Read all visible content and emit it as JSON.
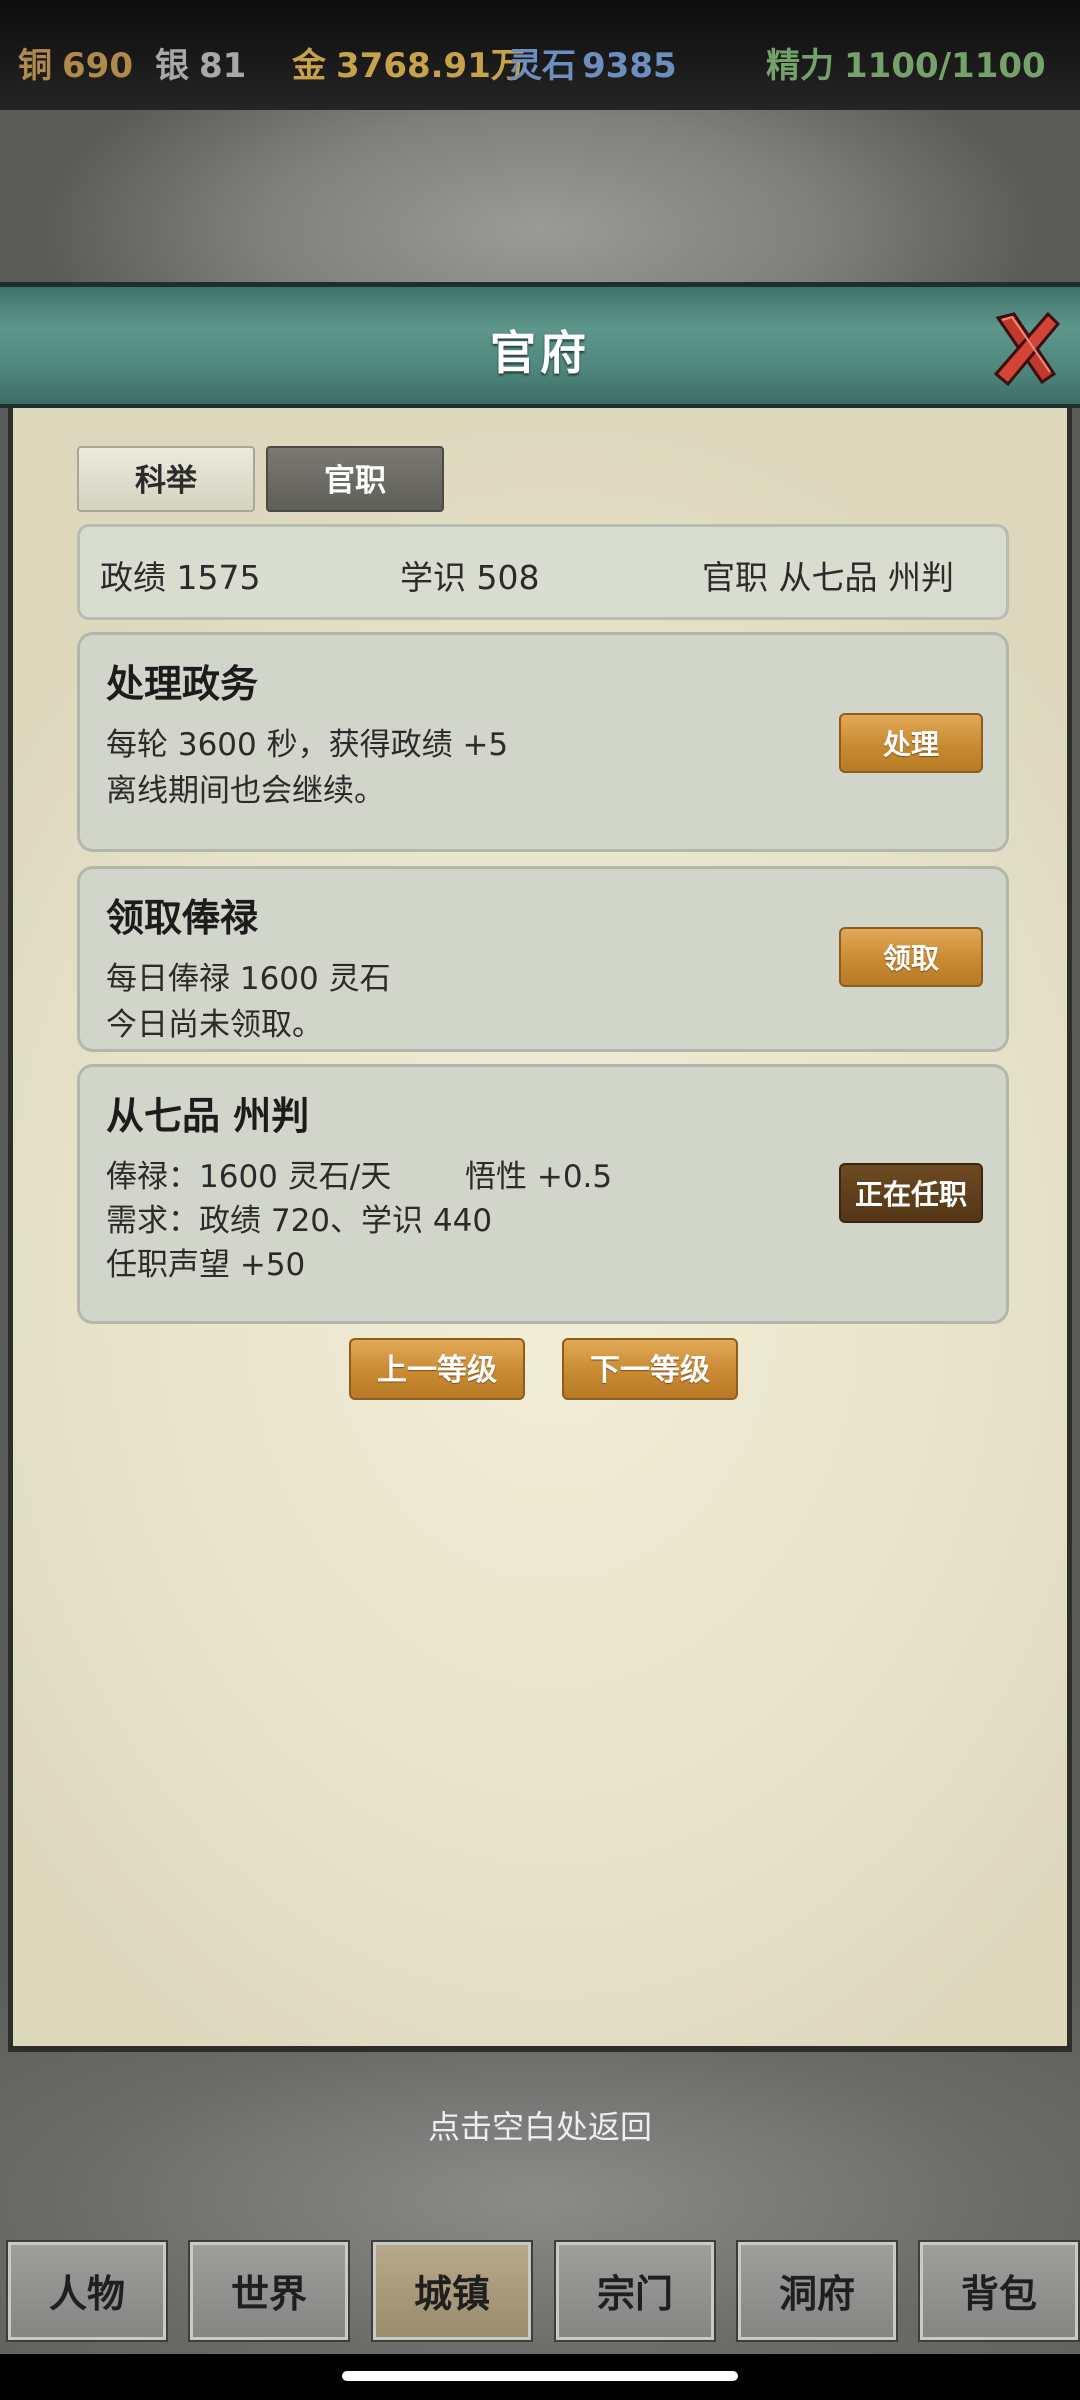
{
  "resources": {
    "copper": {
      "label": "铜",
      "value": "690"
    },
    "silver": {
      "label": "银",
      "value": "81"
    },
    "gold": {
      "label": "金",
      "value": "3768.91万"
    },
    "spirit_stone": {
      "label": "灵石",
      "value": "9385"
    },
    "energy": {
      "label": "精力",
      "value": "1100/1100"
    }
  },
  "dialog": {
    "title": "官府",
    "close_icon": "close-x-icon",
    "tabs": [
      {
        "label": "科举",
        "selected": false
      },
      {
        "label": "官职",
        "selected": true
      }
    ],
    "stats": {
      "merit": "政绩 1575",
      "knowledge": "学识 508",
      "office": "官职 从七品 州判"
    },
    "cards": [
      {
        "title": "处理政务",
        "lines": [
          "每轮 3600 秒，获得政绩 +5",
          "离线期间也会继续。"
        ],
        "button": "处理"
      },
      {
        "title": "领取俸禄",
        "lines": [
          "每日俸禄 1600 灵石",
          "今日尚未领取。"
        ],
        "button": "领取"
      },
      {
        "title": "从七品 州判",
        "lines": [
          "俸禄：1600 灵石/天",
          "悟性 +0.5",
          "需求：政绩 720、学识 440",
          "任职声望 +50"
        ],
        "button": "正在任职"
      }
    ],
    "prev_level": "上一等级",
    "next_level": "下一等级"
  },
  "hint": "点击空白处返回",
  "bottom_nav": [
    {
      "label": "人物",
      "active": false
    },
    {
      "label": "世界",
      "active": false
    },
    {
      "label": "城镇",
      "active": true
    },
    {
      "label": "宗门",
      "active": false
    },
    {
      "label": "洞府",
      "active": false
    },
    {
      "label": "背包",
      "active": false
    }
  ],
  "colors": {
    "header_teal": "#4f877c",
    "parchment": "#e9e5cc",
    "gold_button": "#c98a32",
    "dark_button": "#533617"
  }
}
